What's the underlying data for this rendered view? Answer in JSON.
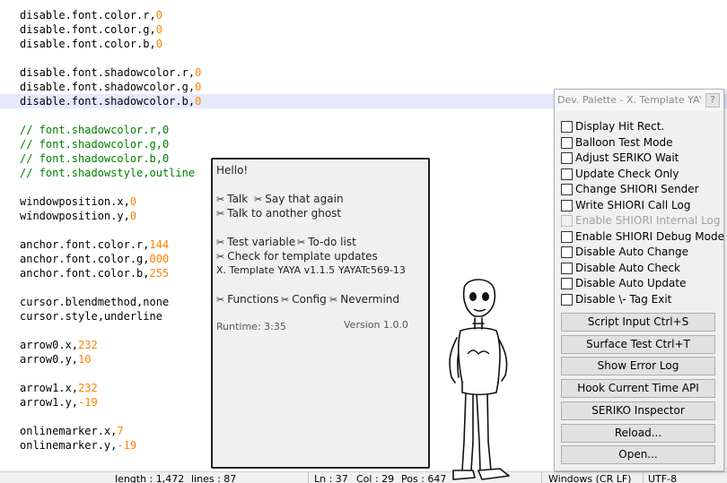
{
  "editor": {
    "lines": [
      {
        "segs": [
          {
            "t": "disable.font.color.r,"
          },
          {
            "t": "0",
            "c": "num"
          }
        ]
      },
      {
        "segs": [
          {
            "t": "disable.font.color.g,"
          },
          {
            "t": "0",
            "c": "num"
          }
        ]
      },
      {
        "segs": [
          {
            "t": "disable.font.color.b,"
          },
          {
            "t": "0",
            "c": "num"
          }
        ]
      },
      {
        "segs": []
      },
      {
        "segs": [
          {
            "t": "disable.font.shadowcolor.r,"
          },
          {
            "t": "0",
            "c": "num"
          }
        ]
      },
      {
        "segs": [
          {
            "t": "disable.font.shadowcolor.g,"
          },
          {
            "t": "0",
            "c": "num"
          }
        ]
      },
      {
        "segs": [
          {
            "t": "disable.font.shadowcolor.b,"
          },
          {
            "t": "0",
            "c": "num"
          }
        ],
        "current": true
      },
      {
        "segs": []
      },
      {
        "segs": [
          {
            "t": "// font.shadowcolor.r,0",
            "c": "cmt"
          }
        ]
      },
      {
        "segs": [
          {
            "t": "// font.shadowcolor.g,0",
            "c": "cmt"
          }
        ]
      },
      {
        "segs": [
          {
            "t": "// font.shadowcolor.b,0",
            "c": "cmt"
          }
        ]
      },
      {
        "segs": [
          {
            "t": "// font.shadowstyle,outline",
            "c": "cmt"
          }
        ]
      },
      {
        "segs": []
      },
      {
        "segs": [
          {
            "t": "windowposition.x,"
          },
          {
            "t": "0",
            "c": "num"
          }
        ]
      },
      {
        "segs": [
          {
            "t": "windowposition.y,"
          },
          {
            "t": "0",
            "c": "num"
          }
        ]
      },
      {
        "segs": []
      },
      {
        "segs": [
          {
            "t": "anchor.font.color.r,"
          },
          {
            "t": "144",
            "c": "num"
          }
        ]
      },
      {
        "segs": [
          {
            "t": "anchor.font.color.g,"
          },
          {
            "t": "000",
            "c": "num"
          }
        ]
      },
      {
        "segs": [
          {
            "t": "anchor.font.color.b,"
          },
          {
            "t": "255",
            "c": "num"
          }
        ]
      },
      {
        "segs": []
      },
      {
        "segs": [
          {
            "t": "cursor.blendmethod,none"
          }
        ]
      },
      {
        "segs": [
          {
            "t": "cursor.style,underline"
          }
        ]
      },
      {
        "segs": []
      },
      {
        "segs": [
          {
            "t": "arrow0.x,"
          },
          {
            "t": "232",
            "c": "num"
          }
        ]
      },
      {
        "segs": [
          {
            "t": "arrow0.y,"
          },
          {
            "t": "10",
            "c": "num"
          }
        ]
      },
      {
        "segs": []
      },
      {
        "segs": [
          {
            "t": "arrow1.x,"
          },
          {
            "t": "232",
            "c": "num"
          }
        ]
      },
      {
        "segs": [
          {
            "t": "arrow1.y,"
          },
          {
            "t": "-19",
            "c": "num"
          }
        ]
      },
      {
        "segs": []
      },
      {
        "segs": [
          {
            "t": "onlinemarker.x,"
          },
          {
            "t": "7",
            "c": "num"
          }
        ]
      },
      {
        "segs": [
          {
            "t": "onlinemarker.y,"
          },
          {
            "t": "-19",
            "c": "num"
          }
        ]
      }
    ]
  },
  "status": {
    "length": "length : 1,472",
    "lines": "lines : 87",
    "ln": "Ln : 37",
    "col": "Col : 29",
    "pos": "Pos : 647",
    "eol": "Windows (CR LF)",
    "encoding": "UTF-8"
  },
  "balloon": {
    "greeting": "Hello!",
    "talk": "Talk",
    "say_again": "Say that again",
    "talk_other": "Talk to another ghost",
    "test_variable": "Test variable",
    "todo": "To-do list",
    "check_updates": "Check for template updates",
    "template_version": "X. Template YAYA v1.1.5",
    "yaya_version": "YAYATc569-13",
    "functions": "Functions",
    "config": "Config",
    "nevermind": "Nevermind",
    "runtime": "Runtime: 3:35",
    "version": "Version 1.0.0",
    "choice_mark": "✂"
  },
  "palette": {
    "title": "Dev. Palette - X. Template YAYA",
    "help": "?",
    "checkboxes": [
      {
        "label": "Display Hit Rect.",
        "enabled": true
      },
      {
        "label": "Balloon Test Mode",
        "enabled": true
      },
      {
        "label": "Adjust SERIKO Wait",
        "enabled": true
      },
      {
        "label": "Update Check Only",
        "enabled": true
      },
      {
        "label": "Change SHIORI Sender",
        "enabled": true
      },
      {
        "label": "Write SHIORI Call Log",
        "enabled": true
      },
      {
        "label": "Enable SHIORI Internal Log",
        "enabled": false
      },
      {
        "label": "Enable SHIORI Debug Mode",
        "enabled": true
      },
      {
        "label": "Disable Auto Change",
        "enabled": true
      },
      {
        "label": "Disable Auto Check",
        "enabled": true
      },
      {
        "label": "Disable Auto Update",
        "enabled": true
      },
      {
        "label": "Disable \\- Tag Exit",
        "enabled": true
      }
    ],
    "buttons": [
      "Script Input Ctrl+S",
      "Surface Test Ctrl+T",
      "Show Error Log",
      "Hook Current Time API",
      "SERIKO Inspector",
      "Reload...",
      "Open..."
    ]
  },
  "colors": {
    "number": "#ff8000",
    "comment": "#008000",
    "current_line": "#e8e8ff"
  }
}
